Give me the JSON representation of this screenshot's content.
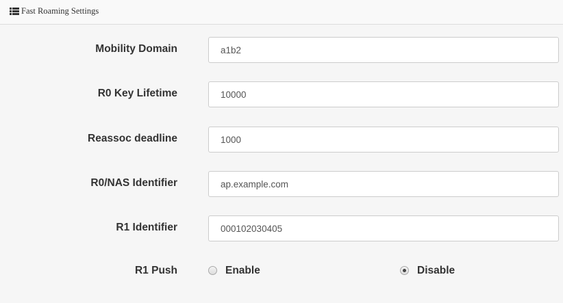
{
  "panel": {
    "title": "Fast Roaming Settings",
    "icon": "list-icon"
  },
  "fields": [
    {
      "label": "Mobility Domain",
      "value": "a1b2"
    },
    {
      "label": "R0 Key Lifetime",
      "value": "10000"
    },
    {
      "label": "Reassoc deadline",
      "value": "1000"
    },
    {
      "label": "R0/NAS Identifier",
      "value": "ap.example.com"
    },
    {
      "label": "R1 Identifier",
      "value": "000102030405"
    }
  ],
  "r1_push": {
    "label": "R1 Push",
    "options": [
      {
        "label": "Enable",
        "checked": false
      },
      {
        "label": "Disable",
        "checked": true
      }
    ]
  }
}
